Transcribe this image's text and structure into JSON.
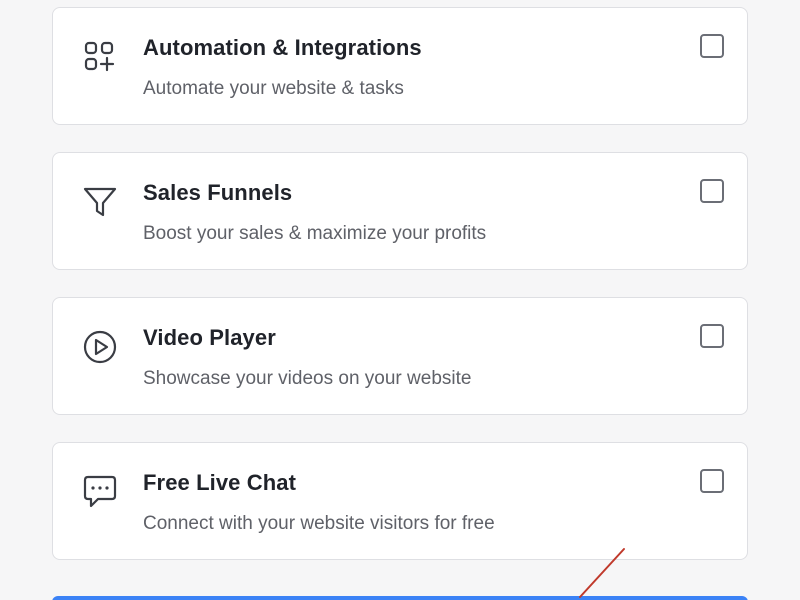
{
  "features": [
    {
      "title": "Automation & Integrations",
      "description": "Automate your website & tasks",
      "icon": "apps-add-icon",
      "checked": false
    },
    {
      "title": "Sales Funnels",
      "description": "Boost your sales & maximize your profits",
      "icon": "funnel-icon",
      "checked": false
    },
    {
      "title": "Video Player",
      "description": "Showcase your videos on your website",
      "icon": "play-circle-icon",
      "checked": false
    },
    {
      "title": "Free Live Chat",
      "description": "Connect with your website visitors for free",
      "icon": "chat-bubble-icon",
      "checked": false
    }
  ],
  "colors": {
    "background": "#f6f6f7",
    "card_border": "#dedfe3",
    "title": "#20232a",
    "description": "#5f6168",
    "checkbox_border": "#6b6e76",
    "primary_button": "#3b82f6",
    "annotation": "#c0392b"
  }
}
